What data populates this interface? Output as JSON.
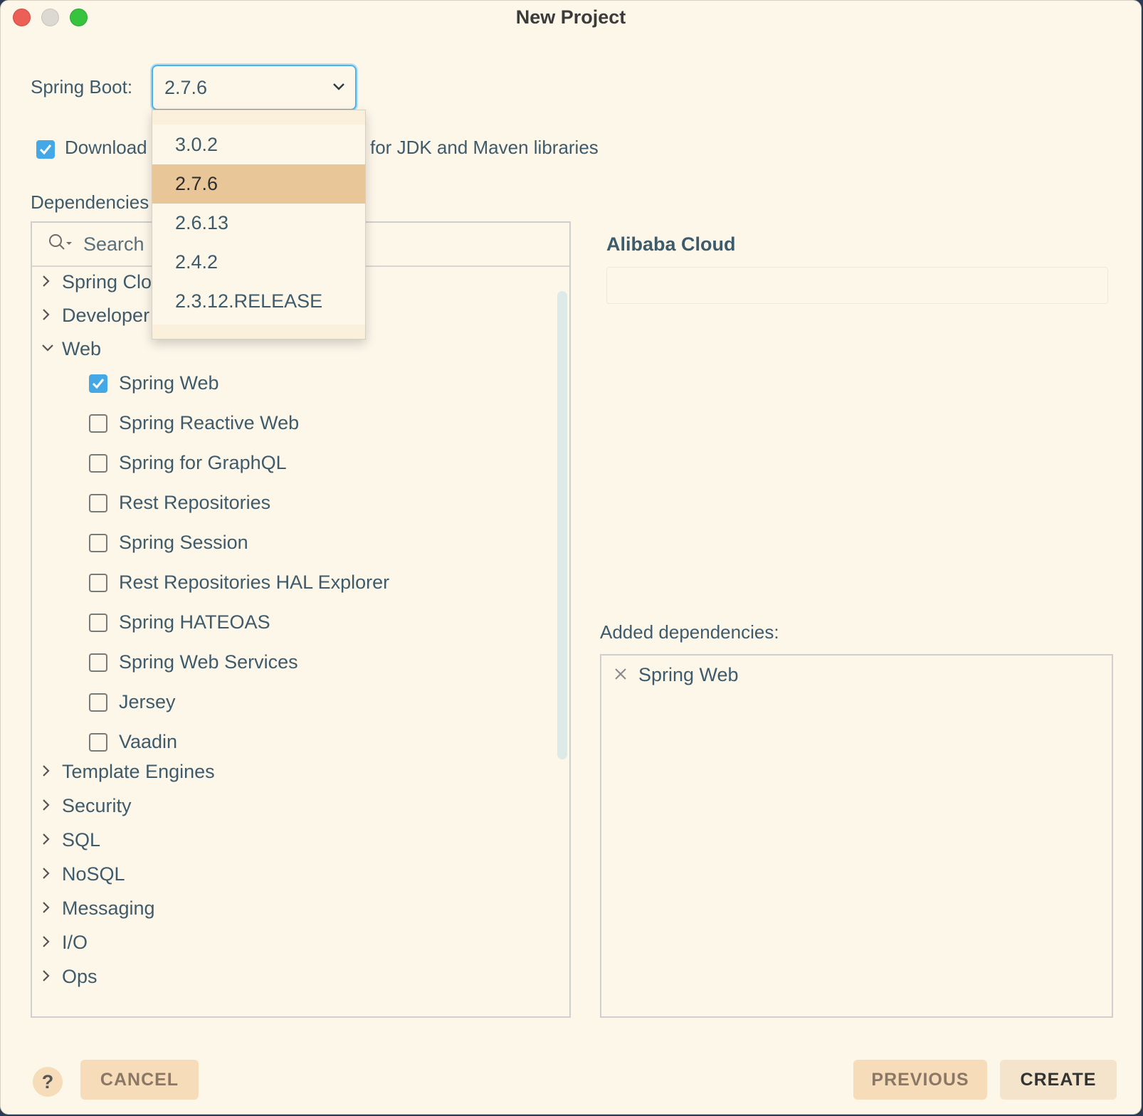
{
  "window": {
    "title": "New Project"
  },
  "spring_boot": {
    "label": "Spring Boot:",
    "selected": "2.7.6"
  },
  "download": {
    "label_left": "Download",
    "label_right": "for JDK and Maven libraries",
    "checked": true
  },
  "dependencies": {
    "label": "Dependencies",
    "search_placeholder": "Search",
    "categories_top": [
      {
        "label": "Spring Clo",
        "expanded": false
      },
      {
        "label": "Developer",
        "expanded": false
      },
      {
        "label": "Web",
        "expanded": true
      }
    ],
    "web_items": [
      {
        "label": "Spring Web",
        "checked": true
      },
      {
        "label": "Spring Reactive Web",
        "checked": false
      },
      {
        "label": "Spring for GraphQL",
        "checked": false
      },
      {
        "label": "Rest Repositories",
        "checked": false
      },
      {
        "label": "Spring Session",
        "checked": false
      },
      {
        "label": "Rest Repositories HAL Explorer",
        "checked": false
      },
      {
        "label": "Spring HATEOAS",
        "checked": false
      },
      {
        "label": "Spring Web Services",
        "checked": false
      },
      {
        "label": "Jersey",
        "checked": false
      },
      {
        "label": "Vaadin",
        "checked": false
      }
    ],
    "categories_bottom": [
      {
        "label": "Template Engines"
      },
      {
        "label": "Security"
      },
      {
        "label": "SQL"
      },
      {
        "label": "NoSQL"
      },
      {
        "label": "Messaging"
      },
      {
        "label": "I/O"
      },
      {
        "label": "Ops"
      }
    ]
  },
  "detail": {
    "title": "Alibaba Cloud"
  },
  "added": {
    "label": "Added dependencies:",
    "items": [
      "Spring Web"
    ]
  },
  "buttons": {
    "help": "?",
    "cancel": "CANCEL",
    "previous": "PREVIOUS",
    "create": "CREATE"
  },
  "version_dropdown": {
    "options": [
      "3.0.2",
      "2.7.6",
      "2.6.13",
      "2.4.2",
      "2.3.12.RELEASE"
    ],
    "selected_index": 1
  },
  "colors": {
    "accent": "#45a8e6",
    "background": "#fdf7ea",
    "selection": "#e9c697",
    "button": "#f6dcb8"
  }
}
